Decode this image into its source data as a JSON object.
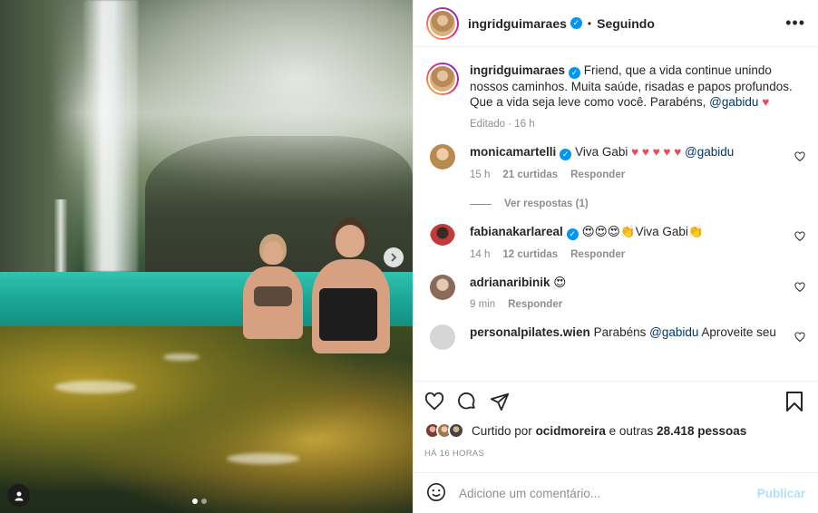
{
  "post_user": {
    "username": "ingridguimaraes",
    "separator": "•",
    "follow_status": "Seguindo"
  },
  "caption": {
    "username": "ingridguimaraes",
    "text": "Friend, que a vida continue unindo nossos caminhos. Muita saúde, risadas e papos profundos. Que a vida seja leve como você. Parabéns,",
    "mention": "@gabidu",
    "emoji": "♥",
    "edited": "Editado · 16 h"
  },
  "comments": [
    {
      "username": "monicamartelli",
      "verified": true,
      "text": "Viva Gabi",
      "emoji": "♥ ♥ ♥ ♥ ♥",
      "mention": "@gabidu",
      "time": "15 h",
      "likes": "21 curtidas",
      "reply": "Responder",
      "view_replies": "Ver respostas (1)"
    },
    {
      "username": "fabianakarlareal",
      "verified": true,
      "text": "😍😍😍👏Viva Gabi👏",
      "time": "14 h",
      "likes": "12 curtidas",
      "reply": "Responder"
    },
    {
      "username": "adrianaribinik",
      "verified": false,
      "text": "😍",
      "time": "9 min",
      "reply": "Responder"
    },
    {
      "username": "personalpilates.wien",
      "verified": false,
      "text": "Parabéns",
      "mention": "@gabidu",
      "text_after": "Aproveite seu"
    }
  ],
  "likes_summary": {
    "prefix": "Curtido por",
    "user": "ocidmoreira",
    "suffix": "e outras",
    "count": "28.418 pessoas"
  },
  "timestamp": "HÁ 16 HORAS",
  "comment_box": {
    "placeholder": "Adicione um comentário...",
    "post_label": "Publicar"
  },
  "icons": {
    "more": "more-options-icon",
    "like": "heart-icon",
    "comment": "comment-icon",
    "share": "share-icon",
    "save": "bookmark-icon",
    "emoji": "emoji-icon",
    "next": "chevron-right-icon",
    "tag": "user-tag-icon"
  },
  "colors": {
    "verified": "#0095f6",
    "mention": "#00376b",
    "heart": "#ed4956",
    "post_disabled": "#b2dffc",
    "muted": "#8e8e8e"
  }
}
